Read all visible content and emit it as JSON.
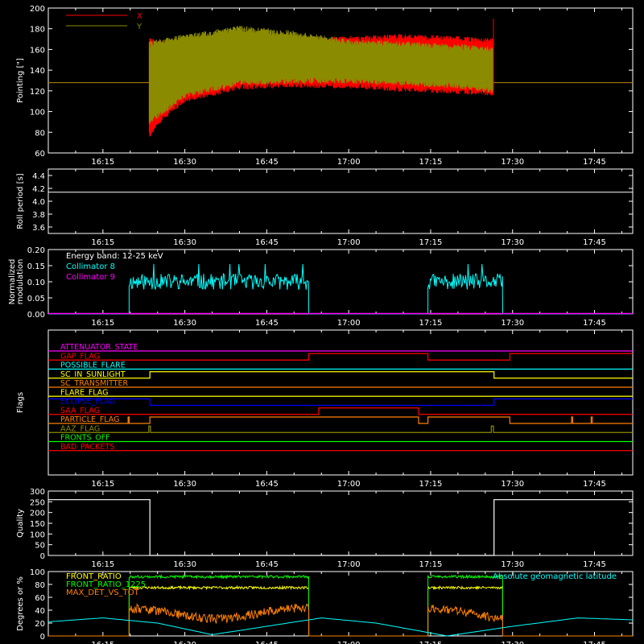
{
  "figure": {
    "x_tick_labels": [
      "16:15",
      "16:30",
      "16:45",
      "17:00",
      "17:15",
      "17:30",
      "17:45"
    ],
    "x_tick_minutes": [
      975,
      990,
      1005,
      1020,
      1035,
      1050,
      1065
    ],
    "x_range_minutes": [
      965,
      1072
    ]
  },
  "chart_data": [
    {
      "type": "line",
      "ylabel": "Pointing [\"]",
      "ylim": [
        60,
        200
      ],
      "yticks": [
        60,
        80,
        100,
        120,
        140,
        160,
        180,
        200
      ],
      "legend": "top-left",
      "series": [
        {
          "name": "X",
          "color": "#ff0000",
          "active_x": [
            983.5,
            1046.5
          ],
          "upper": [
            [
              983.5,
              168
            ],
            [
              990,
              162
            ],
            [
              1000,
              165
            ],
            [
              1010,
              168
            ],
            [
              1020,
              170
            ],
            [
              1030,
              172
            ],
            [
              1040,
              170
            ],
            [
              1046.5,
              168
            ]
          ],
          "lower": [
            [
              983.5,
              78
            ],
            [
              986,
              95
            ],
            [
              990,
              112
            ],
            [
              1000,
              124
            ],
            [
              1010,
              126
            ],
            [
              1020,
              125
            ],
            [
              1030,
              122
            ],
            [
              1040,
              120
            ],
            [
              1046.5,
              118
            ]
          ],
          "baseline": 128
        },
        {
          "name": "Y",
          "color": "#8b8b00",
          "active_x": [
            983.5,
            1046.5
          ],
          "upper": [
            [
              983.5,
              165
            ],
            [
              990,
              172
            ],
            [
              1000,
              180
            ],
            [
              1010,
              175
            ],
            [
              1020,
              167
            ],
            [
              1030,
              165
            ],
            [
              1040,
              162
            ],
            [
              1046.5,
              160
            ]
          ],
          "lower": [
            [
              983.5,
              90
            ],
            [
              986,
              100
            ],
            [
              990,
              116
            ],
            [
              1000,
              128
            ],
            [
              1010,
              130
            ],
            [
              1020,
              130
            ],
            [
              1030,
              128
            ],
            [
              1040,
              125
            ],
            [
              1046.5,
              120
            ]
          ],
          "baseline": 128
        }
      ]
    },
    {
      "type": "line",
      "ylabel": "Roll period [s]",
      "ylim": [
        3.5,
        4.5
      ],
      "yticks": [
        3.6,
        3.8,
        4.0,
        4.2,
        4.4
      ],
      "series": [
        {
          "name": "",
          "color": "#ffffff",
          "constant": 4.14
        }
      ]
    },
    {
      "type": "line",
      "ylabel": "Normalized modulation",
      "ylim": [
        0,
        0.2
      ],
      "yticks": [
        "0.00",
        "0.05",
        "0.10",
        "0.15",
        "0.20"
      ],
      "annotation": "Energy band: 12-25 keV",
      "series": [
        {
          "name": "Collimator 8",
          "color": "#00ffff",
          "intervals": [
            [
              979.8,
              1012.7
            ],
            [
              1034.5,
              1048.2
            ]
          ],
          "level": 0.1
        },
        {
          "name": "Collimator 9",
          "color": "#ff00ff",
          "constant": 0.0
        }
      ]
    },
    {
      "type": "line",
      "ylabel": "Flags",
      "flags": [
        {
          "name": "ATTENUATOR_STATE",
          "color": "#ff00ff",
          "high_intervals": []
        },
        {
          "name": "GAP_FLAG",
          "color": "#ff0000",
          "high_intervals": [
            [
              1012.7,
              1034.5
            ],
            [
              1049.5,
              1072
            ]
          ]
        },
        {
          "name": "POSSIBLE_FLARE",
          "color": "#00ffff",
          "high_intervals": []
        },
        {
          "name": "SC_IN_SUNLIGHT",
          "color": "#ffff00",
          "high_intervals": [
            [
              983.6,
              1046.6
            ]
          ]
        },
        {
          "name": "SC_TRANSMITTER",
          "color": "#ff8000",
          "high_intervals": []
        },
        {
          "name": "FLARE_FLAG",
          "color": "#ffff00",
          "high_intervals": []
        },
        {
          "name": "ECLIPSE_FLAG",
          "color": "#0000ff",
          "high_intervals": [
            [
              965,
              983.6
            ],
            [
              1046.6,
              1072
            ]
          ]
        },
        {
          "name": "SAA_FLAG",
          "color": "#ff0000",
          "high_intervals": [
            [
              1014.5,
              1032.8
            ]
          ]
        },
        {
          "name": "PARTICLE_FLAG",
          "color": "#ff8000",
          "high_intervals": [
            [
              979.6,
              979.8
            ],
            [
              983.6,
              1032.8
            ],
            [
              1034.5,
              1049.5
            ],
            [
              1060.8,
              1061
            ],
            [
              1064.4,
              1064.6
            ]
          ]
        },
        {
          "name": "AAZ_FLAG",
          "color": "#8b8b00",
          "high_intervals": [
            [
              983.4,
              983.7
            ],
            [
              1046.1,
              1046.5
            ]
          ]
        },
        {
          "name": "FRONTS_OFF",
          "color": "#00ff00",
          "high_intervals": []
        },
        {
          "name": "BAD_PACKETS",
          "color": "#ff0000",
          "high_intervals": []
        }
      ]
    },
    {
      "type": "line",
      "ylabel": "Quality",
      "ylim": [
        0,
        300
      ],
      "yticks": [
        0,
        50,
        100,
        150,
        200,
        250,
        300
      ],
      "series": [
        {
          "name": "",
          "color": "#ffffff",
          "steps": [
            [
              965,
              260
            ],
            [
              983.6,
              0
            ],
            [
              1046.6,
              260
            ]
          ]
        }
      ]
    },
    {
      "type": "line",
      "ylabel": "Degrees or %",
      "ylim": [
        0,
        100
      ],
      "yticks": [
        0,
        20,
        40,
        60,
        80,
        100
      ],
      "series": [
        {
          "name": "FRONT_RATIO",
          "color": "#ffff00",
          "intervals": [
            [
              979.8,
              1012.7
            ],
            [
              1034.5,
              1048.2
            ]
          ],
          "level": 75
        },
        {
          "name": "FRONT_RATIO_1225",
          "color": "#00ff00",
          "intervals": [
            [
              979.8,
              1012.7
            ],
            [
              1034.5,
              1048.2
            ]
          ],
          "level": 92
        },
        {
          "name": "MAX_DET_VS_TOT",
          "color": "#ff8000",
          "intervals": [
            [
              979.8,
              1012.7
            ],
            [
              1034.5,
              1048.2
            ]
          ],
          "level": 35
        },
        {
          "name": "Absolute geomagnetic latitude",
          "color": "#00ffff",
          "points": [
            [
              965,
              22
            ],
            [
              975,
              28
            ],
            [
              985,
              20
            ],
            [
              995,
              2
            ],
            [
              1005,
              15
            ],
            [
              1015,
              28
            ],
            [
              1025,
              20
            ],
            [
              1038,
              0
            ],
            [
              1050,
              15
            ],
            [
              1062,
              28
            ],
            [
              1072,
              25
            ]
          ]
        }
      ]
    }
  ]
}
